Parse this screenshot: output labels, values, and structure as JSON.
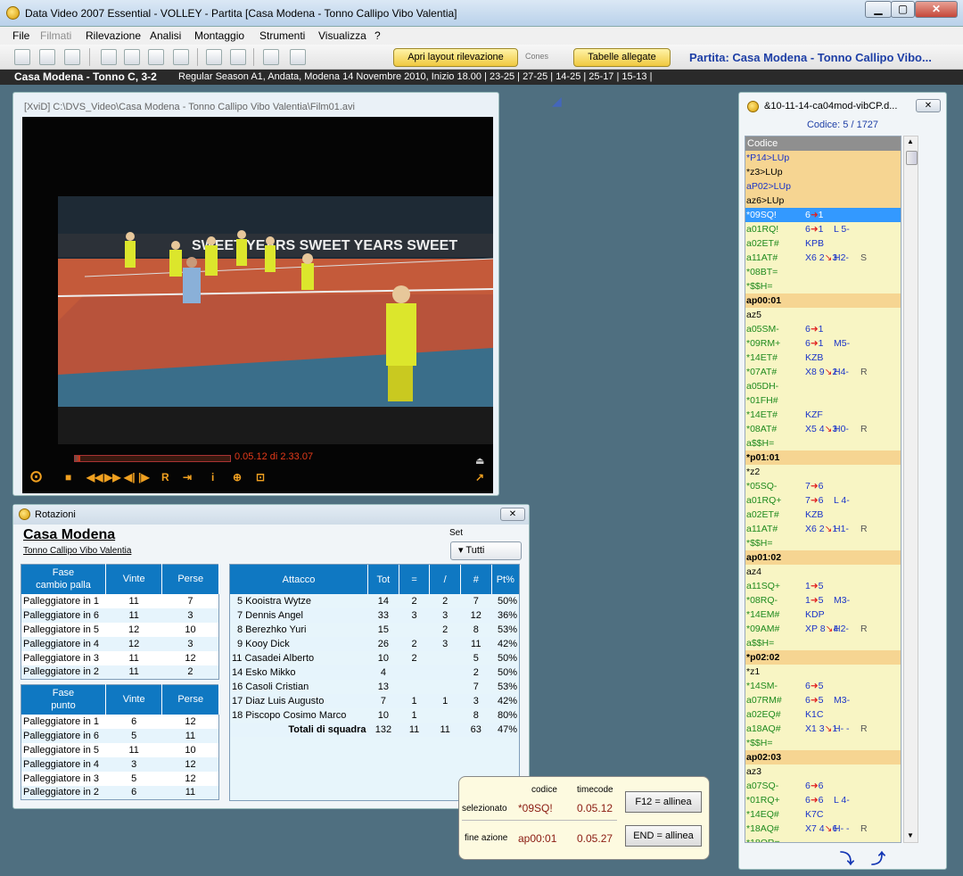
{
  "window": {
    "title": "Data Video 2007 Essential - VOLLEY - Partita [Casa Modena - Tonno Callipo Vibo Valentia]"
  },
  "menu": [
    "File",
    "Filmati",
    "Rilevazione",
    "Analisi",
    "Montaggio",
    "Strumenti",
    "Visualizza",
    "?"
  ],
  "toolbar": {
    "layout_btn": "Apri layout rilevazione",
    "cones": "Cones",
    "tabelle_btn": "Tabelle allegate",
    "partita": "Partita: Casa Modena - Tonno Callipo Vibo..."
  },
  "status": {
    "match": "Casa Modena - Tonno C, 3-2",
    "info": "Regular Season A1, Andata, Modena 14 Novembre 2010, Inizio 18.00    | 23-25 | 27-25 | 14-25 | 25-17 | 15-13 |"
  },
  "video": {
    "path": "[XviD] C:\\DVS_Video\\Casa Modena - Tonno Callipo Vibo Valentia\\Film01.avi",
    "time": "0.05.12 di 2.33.07",
    "progress": 0.037
  },
  "rotazioni": {
    "title": "Rotazioni",
    "team": "Casa Modena",
    "opponent": "Tonno Callipo Vibo Valentia",
    "set_label": "Set",
    "set_value": "Tutti",
    "cambio": {
      "h1": "Fase\ncambio palla",
      "h2": "Vinte",
      "h3": "Perse",
      "rows": [
        [
          "Palleggiatore in 1",
          "11",
          "7"
        ],
        [
          "Palleggiatore in 6",
          "11",
          "3"
        ],
        [
          "Palleggiatore in 5",
          "12",
          "10"
        ],
        [
          "Palleggiatore in 4",
          "12",
          "3"
        ],
        [
          "Palleggiatore in 3",
          "11",
          "12"
        ],
        [
          "Palleggiatore in 2",
          "11",
          "2"
        ]
      ]
    },
    "punto": {
      "h1": "Fase\npunto",
      "h2": "Vinte",
      "h3": "Perse",
      "rows": [
        [
          "Palleggiatore in 1",
          "6",
          "12"
        ],
        [
          "Palleggiatore in 6",
          "5",
          "11"
        ],
        [
          "Palleggiatore in 5",
          "11",
          "10"
        ],
        [
          "Palleggiatore in 4",
          "3",
          "12"
        ],
        [
          "Palleggiatore in 3",
          "5",
          "12"
        ],
        [
          "Palleggiatore in 2",
          "6",
          "11"
        ]
      ]
    },
    "attacco": {
      "headers": [
        "Attacco",
        "Tot",
        "=",
        "/",
        "#",
        "Pt%"
      ],
      "rows": [
        [
          "5 Kooistra Wytze",
          "14",
          "2",
          "2",
          "7",
          "50%"
        ],
        [
          "7 Dennis Angel",
          "33",
          "3",
          "3",
          "12",
          "36%"
        ],
        [
          "8 Berezhko Yuri",
          "15",
          "",
          "2",
          "8",
          "53%"
        ],
        [
          "9 Kooy Dick",
          "26",
          "2",
          "3",
          "11",
          "42%"
        ],
        [
          "11 Casadei Alberto",
          "10",
          "2",
          "",
          "5",
          "50%"
        ],
        [
          "14 Esko Mikko",
          "4",
          "",
          "",
          "2",
          "50%"
        ],
        [
          "16 Casoli Cristian",
          "13",
          "",
          "",
          "7",
          "53%"
        ],
        [
          "17 Diaz Luis Augusto",
          "7",
          "1",
          "1",
          "3",
          "42%"
        ],
        [
          "18 Piscopo Cosimo Marco",
          "10",
          "1",
          "",
          "8",
          "80%"
        ]
      ],
      "totals": [
        "Totali di squadra",
        "132",
        "11",
        "11",
        "63",
        "47%"
      ]
    }
  },
  "events": {
    "title": "&10-11-14-ca04mod-vibCP.d...",
    "codice": "Codice: 5 / 1727",
    "header": "Codice",
    "rows": [
      {
        "k": "kdarkb",
        "c": "*P14>LUp"
      },
      {
        "k": "kdark",
        "c": "*z3>LUp"
      },
      {
        "k": "kdarkb",
        "c": "aP02>LUp"
      },
      {
        "k": "kdark",
        "c": "az6>LUp"
      },
      {
        "k": "sel",
        "c": "*09SQ!",
        "x": "6",
        "y": "1",
        "yt": "arr"
      },
      {
        "k": "home",
        "c": "a01RQ!",
        "x": "6",
        "y": "1",
        "yt": "arr",
        "z": "L 5-"
      },
      {
        "k": "home",
        "c": "a02ET#",
        "x": "KPB"
      },
      {
        "k": "home",
        "c": "a11AT#",
        "x": "X6",
        "y": "2",
        "yt": "diag",
        "n": "3",
        "z": "H2-",
        "w": "S"
      },
      {
        "k": "home",
        "c": "*08BT="
      },
      {
        "k": "home",
        "c": "*$$H="
      },
      {
        "k": "bold",
        "c": "ap00:01"
      },
      {
        "k": "plain",
        "c": "az5"
      },
      {
        "k": "home",
        "c": "a05SM-",
        "x": "6",
        "y": "1",
        "yt": "arr"
      },
      {
        "k": "home",
        "c": "*09RM+",
        "x": "6",
        "y": "1",
        "yt": "arr",
        "z": "M5-"
      },
      {
        "k": "home",
        "c": "*14ET#",
        "x": "KZB"
      },
      {
        "k": "home",
        "c": "*07AT#",
        "x": "X8",
        "y": "9",
        "yt": "diag",
        "n": "2",
        "z": "H4-",
        "w": "R"
      },
      {
        "k": "home",
        "c": "a05DH-"
      },
      {
        "k": "home",
        "c": "*01FH#"
      },
      {
        "k": "home",
        "c": "*14ET#",
        "x": "KZF"
      },
      {
        "k": "home",
        "c": "*08AT#",
        "x": "X5",
        "y": "4",
        "yt": "diag",
        "n": "3",
        "z": "H0-",
        "w": "R"
      },
      {
        "k": "home",
        "c": "a$$H="
      },
      {
        "k": "bold",
        "c": "*p01:01"
      },
      {
        "k": "plain",
        "c": "*z2"
      },
      {
        "k": "home",
        "c": "*05SQ-",
        "x": "7",
        "y": "6",
        "yt": "arr"
      },
      {
        "k": "home",
        "c": "a01RQ+",
        "x": "7",
        "y": "6",
        "yt": "arr",
        "z": "L 4-"
      },
      {
        "k": "home",
        "c": "a02ET#",
        "x": "KZB"
      },
      {
        "k": "home",
        "c": "a11AT#",
        "x": "X6",
        "y": "2",
        "yt": "diag",
        "n": "1",
        "z": "H1-",
        "w": "R"
      },
      {
        "k": "home",
        "c": "*$$H="
      },
      {
        "k": "bold",
        "c": "ap01:02"
      },
      {
        "k": "plain",
        "c": "az4"
      },
      {
        "k": "home",
        "c": "a11SQ+",
        "x": "1",
        "y": "5",
        "yt": "arr"
      },
      {
        "k": "home",
        "c": "*08RQ-",
        "x": "1",
        "y": "5",
        "yt": "arr",
        "z": "M3-"
      },
      {
        "k": "home",
        "c": "*14EM#",
        "x": "KDP"
      },
      {
        "k": "home",
        "c": "*09AM#",
        "x": "XP",
        "y": "8",
        "yt": "diag",
        "n": "4",
        "z": "H2-",
        "w": "R"
      },
      {
        "k": "home",
        "c": "a$$H="
      },
      {
        "k": "bold",
        "c": "*p02:02"
      },
      {
        "k": "plain",
        "c": "*z1"
      },
      {
        "k": "home",
        "c": "*14SM-",
        "x": "6",
        "y": "5",
        "yt": "arr"
      },
      {
        "k": "home",
        "c": "a07RM#",
        "x": "6",
        "y": "5",
        "yt": "arr",
        "z": "M3-"
      },
      {
        "k": "home",
        "c": "a02EQ#",
        "x": "K1C"
      },
      {
        "k": "home",
        "c": "a18AQ#",
        "x": "X1",
        "y": "3",
        "yt": "diag",
        "n": "1",
        "z": "H- -",
        "w": "R"
      },
      {
        "k": "home",
        "c": "*$$H="
      },
      {
        "k": "bold",
        "c": "ap02:03"
      },
      {
        "k": "plain",
        "c": "az3"
      },
      {
        "k": "home",
        "c": "a07SQ-",
        "x": "6",
        "y": "6",
        "yt": "arr"
      },
      {
        "k": "home",
        "c": "*01RQ+",
        "x": "6",
        "y": "6",
        "yt": "arr",
        "z": "L 4-"
      },
      {
        "k": "home",
        "c": "*14EQ#",
        "x": "K7C"
      },
      {
        "k": "home",
        "c": "*18AQ#",
        "x": "X7",
        "y": "4",
        "yt": "diag",
        "n": "6",
        "z": "H- -",
        "w": "R"
      },
      {
        "k": "home",
        "c": "*18OR="
      }
    ]
  },
  "timecode": {
    "h_codice": "codice",
    "h_timecode": "timecode",
    "l_sel": "selezionato",
    "sel_code": "*09SQ!",
    "sel_tc": "0.05.12",
    "l_fine": "fine azione",
    "fine_code": "ap00:01",
    "fine_tc": "0.05.27",
    "f12": "F12 = allinea",
    "end": "END = allinea"
  }
}
